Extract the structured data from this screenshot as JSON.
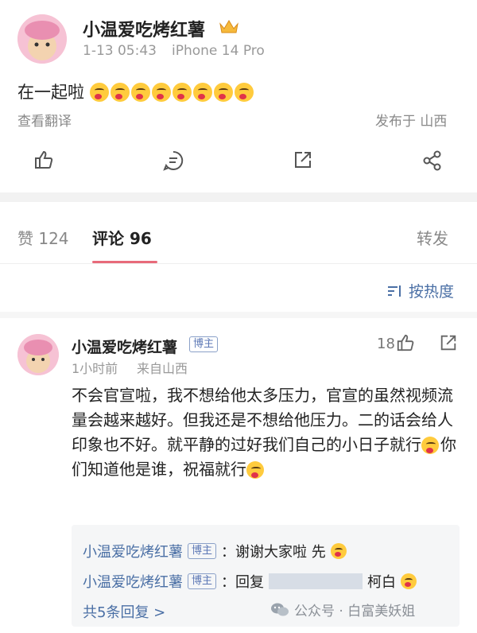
{
  "post": {
    "author": "小温爱吃烤红薯",
    "time": "1-13 05:43",
    "device": "iPhone 14 Pro",
    "text": "在一起啦",
    "translate": "查看翻译",
    "location": "发布于 山西"
  },
  "tabs": {
    "likes": "赞 124",
    "comments": "评论 96",
    "reposts": "转发"
  },
  "sort": {
    "label": "按热度"
  },
  "comment": {
    "author": "小温爱吃烤红薯",
    "badge": "博主",
    "time": "1小时前",
    "from": "来自山西",
    "like_count": "18",
    "text_1": "不会官宣啦，我不想给他太多压力，官宣的虽然视频流量会越来越好。但我还是不想给他压力。二的话会给人印象也不好。就平静的过好我们自己的小日子就行",
    "text_2": "你们知道他是谁，祝福就行"
  },
  "replies": [
    {
      "author": "小温爱吃烤红薯",
      "badge": "博主",
      "text": "：谢谢大家啦 先"
    },
    {
      "author": "小温爱吃烤红薯",
      "badge": "博主",
      "text_a": "：回复",
      "text_b": "柯白"
    }
  ],
  "more_replies": "共5条回复 >",
  "watermark": "公众号 · 白富美妖姐",
  "colors": {
    "link": "#4a6fa5",
    "accent": "#e86a7a",
    "text": "#222222",
    "muted": "#999999"
  }
}
